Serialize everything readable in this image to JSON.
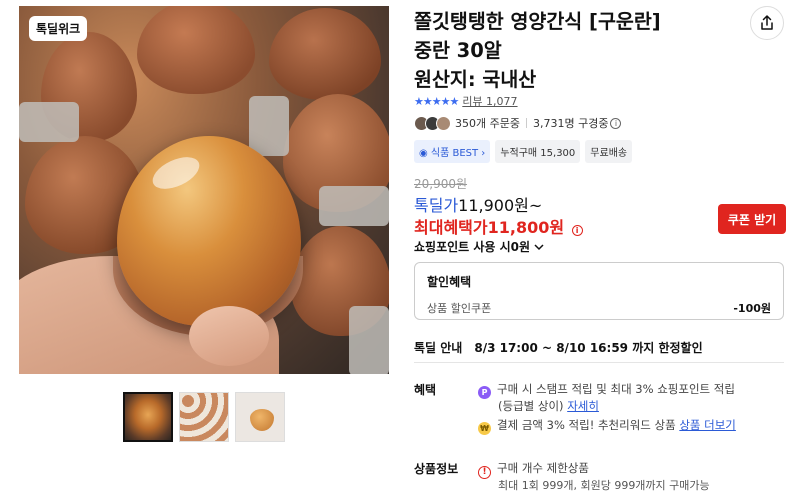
{
  "gallery": {
    "badge": "톡딜위크",
    "thumbnails": [
      "thumb-1",
      "thumb-2",
      "thumb-3"
    ]
  },
  "product": {
    "title": "쫄깃탱탱한 영양간식 [구운란]\n중란 30알\n원산지: 국내산",
    "rating_stars": "★★★★★",
    "review_label": "리뷰 1,077",
    "orders": "350개 주문중",
    "subscribers": "3,731명 구경중",
    "tags": [
      "식품 BEST",
      "누적구매 15,300",
      "무료배송"
    ]
  },
  "price": {
    "original": "20,900원",
    "deal_label": "톡딜가",
    "deal_value": "11,900원~",
    "max_label": "최대혜택가",
    "max_value": "11,800원",
    "coupon_button": "쿠폰 받기",
    "point_use": "쇼핑포인트 사용 시0원"
  },
  "discount": {
    "title": "할인혜택",
    "label": "상품 할인쿠폰",
    "amount": "-100원"
  },
  "deal_info": {
    "label": "톡딜 안내",
    "period": "8/3 17:00 ~ 8/10 16:59 까지 한정할인"
  },
  "benefit": {
    "label": "혜택",
    "line1": "구매 시 스탬프 적립 및 최대 3% 쇼핑포인트 적립",
    "line2_prefix": "(등급별 상이)",
    "line2_link": "자세히",
    "line3_prefix": "결제 금액 3% 적립! 추천리워드 상품",
    "line3_link": "상품 더보기"
  },
  "product_info": {
    "label": "상품정보",
    "line1": "구매 개수 제한상품",
    "line2": "최대 1회 999개, 회원당 999개까지 구매가능"
  },
  "colors": {
    "accent_blue": "#2b5ad6",
    "accent_red": "#e0251f"
  }
}
